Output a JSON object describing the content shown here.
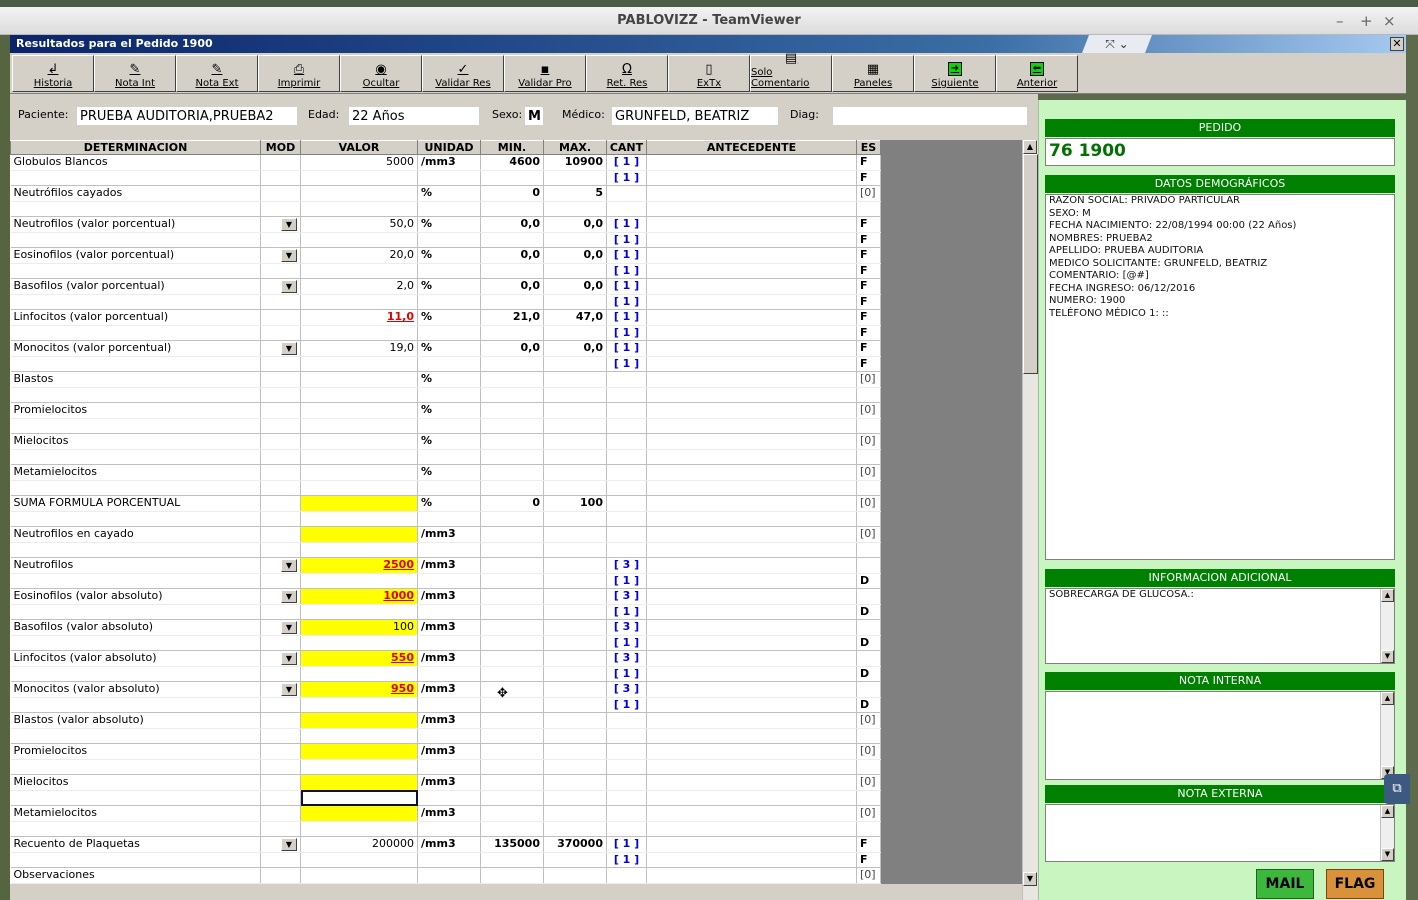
{
  "teamviewer": {
    "title": "PABLOVIZZ - TeamViewer",
    "min": "–",
    "max": "+",
    "close": "×"
  },
  "window": {
    "title": "Resultados para el Pedido 1900",
    "close": "✕"
  },
  "toolbar": [
    {
      "icon": "↲",
      "label": "Historia"
    },
    {
      "icon": "✎",
      "label": "Nota Int"
    },
    {
      "icon": "✎",
      "label": "Nota Ext"
    },
    {
      "icon": "⎙",
      "label": "Imprimir"
    },
    {
      "icon": "◉",
      "label": "Ocultar"
    },
    {
      "icon": "✓",
      "label": "Validar Res"
    },
    {
      "icon": "▪",
      "label": "Validar Pro"
    },
    {
      "icon": "Ω",
      "label": "Ret. Res"
    },
    {
      "icon": "▯",
      "label": "ExTx"
    },
    {
      "icon": "▤",
      "label": "Solo Comentario"
    },
    {
      "icon": "▦",
      "label": "Paneles"
    },
    {
      "icon": "➜",
      "label": "Siguiente"
    },
    {
      "icon": "⬅",
      "label": "Anterior"
    }
  ],
  "patient": {
    "paciente_label": "Paciente:",
    "paciente": "PRUEBA AUDITORIA,PRUEBA2",
    "edad_label": "Edad:",
    "edad": "22 Años",
    "sexo_label": "Sexo:",
    "sexo": "M",
    "medico_label": "Médico:",
    "medico": "GRUNFELD, BEATRIZ",
    "diag_label": "Diag:",
    "diag": ""
  },
  "columns": [
    "DETERMINACION",
    "MOD",
    "VALOR",
    "UNIDAD",
    "MIN.",
    "MAX.",
    "CANT",
    "ANTECEDENTE",
    "ES"
  ],
  "rows": [
    {
      "det": "Globulos Blancos",
      "mod": false,
      "val": "5000",
      "unit": "/mm3",
      "min": "4600",
      "max": "10900",
      "cant": "[ 1 ]",
      "es": "F",
      "cant2": "[ 1 ]",
      "es2": "F"
    },
    {
      "det": "Neutrófilos cayados",
      "mod": false,
      "val": "",
      "unit": "%",
      "min": "0",
      "max": "5",
      "cant": "",
      "es": "[0]"
    },
    {
      "det": "Neutrofilos  (valor porcentual)",
      "mod": true,
      "val": "50,0",
      "unit": "%",
      "min": "0,0",
      "max": "0,0",
      "cant": "[ 1 ]",
      "es": "F",
      "cant2": "[ 1 ]",
      "es2": "F"
    },
    {
      "det": "Eosinofilos (valor porcentual)",
      "mod": true,
      "val": "20,0",
      "unit": "%",
      "min": "0,0",
      "max": "0,0",
      "cant": "[ 1 ]",
      "es": "F",
      "cant2": "[ 1 ]",
      "es2": "F"
    },
    {
      "det": "Basofilos (valor porcentual)",
      "mod": true,
      "val": "2,0",
      "unit": "%",
      "min": "0,0",
      "max": "0,0",
      "cant": "[ 1 ]",
      "es": "F",
      "cant2": "[ 1 ]",
      "es2": "F"
    },
    {
      "det": "Linfocitos (valor porcentual)",
      "mod": false,
      "val": "11,0",
      "abn": true,
      "unit": "%",
      "min": "21,0",
      "max": "47,0",
      "cant": "[ 1 ]",
      "es": "F",
      "cant2": "[ 1 ]",
      "es2": "F"
    },
    {
      "det": "Monocitos (valor porcentual)",
      "mod": true,
      "val": "19,0",
      "unit": "%",
      "min": "0,0",
      "max": "0,0",
      "cant": "[ 1 ]",
      "es": "F",
      "cant2": "[ 1 ]",
      "es2": "F"
    },
    {
      "det": "Blastos",
      "mod": false,
      "val": "",
      "unit": "%",
      "min": "",
      "max": "",
      "cant": "",
      "es": "[0]"
    },
    {
      "det": "Promielocitos",
      "mod": false,
      "val": "",
      "unit": "%",
      "min": "",
      "max": "",
      "cant": "",
      "es": "[0]"
    },
    {
      "det": "Mielocitos",
      "mod": false,
      "val": "",
      "unit": "%",
      "min": "",
      "max": "",
      "cant": "",
      "es": "[0]"
    },
    {
      "det": "Metamielocitos",
      "mod": false,
      "val": "",
      "unit": "%",
      "min": "",
      "max": "",
      "cant": "",
      "es": "[0]"
    },
    {
      "det": "SUMA FORMULA PORCENTUAL",
      "mod": false,
      "val": "",
      "yellow": true,
      "unit": "%",
      "min": "0",
      "max": "100",
      "cant": "",
      "es": "[0]"
    },
    {
      "det": "Neutrofilos en cayado",
      "mod": false,
      "val": "",
      "yellow": true,
      "unit": "/mm3",
      "min": "",
      "max": "",
      "cant": "",
      "es": "[0]"
    },
    {
      "det": "Neutrofilos",
      "mod": true,
      "val": "2500",
      "yellow": true,
      "abn": true,
      "unit": "/mm3",
      "min": "",
      "max": "",
      "cant": "[ 3 ]",
      "es": "",
      "cant2": "[ 1 ]",
      "es2": "D"
    },
    {
      "det": "Eosinofilos (valor absoluto)",
      "mod": true,
      "val": "1000",
      "yellow": true,
      "abn": true,
      "unit": "/mm3",
      "min": "",
      "max": "",
      "cant": "[ 3 ]",
      "es": "",
      "cant2": "[ 1 ]",
      "es2": "D"
    },
    {
      "det": "Basofilos (valor absoluto)",
      "mod": true,
      "val": "100",
      "yellow": true,
      "unit": "/mm3",
      "min": "",
      "max": "",
      "cant": "[ 3 ]",
      "es": "",
      "cant2": "[ 1 ]",
      "es2": "D"
    },
    {
      "det": "Linfocitos (valor absoluto)",
      "mod": true,
      "val": "550",
      "yellow": true,
      "abn": true,
      "unit": "/mm3",
      "min": "",
      "max": "",
      "cant": "[ 3 ]",
      "es": "",
      "cant2": "[ 1 ]",
      "es2": "D"
    },
    {
      "det": "Monocitos (valor absoluto)",
      "mod": true,
      "val": "950",
      "yellow": true,
      "abn": true,
      "unit": "/mm3",
      "min": "",
      "max": "",
      "cant": "[ 3 ]",
      "es": "",
      "cant2": "[ 1 ]",
      "es2": "D"
    },
    {
      "det": "Blastos (valor absoluto)",
      "mod": false,
      "val": "",
      "yellow": true,
      "unit": "/mm3",
      "min": "",
      "max": "",
      "cant": "",
      "es": "[0]"
    },
    {
      "det": "Promielocitos",
      "mod": false,
      "val": "",
      "yellow": true,
      "unit": "/mm3",
      "min": "",
      "max": "",
      "cant": "",
      "es": "[0]"
    },
    {
      "det": "Mielocitos",
      "mod": false,
      "val": "",
      "yellow": true,
      "sel2": true,
      "unit": "/mm3",
      "min": "",
      "max": "",
      "cant": "",
      "es": "[0]"
    },
    {
      "det": "Metamielocitos",
      "mod": false,
      "val": "",
      "yellow": true,
      "unit": "/mm3",
      "min": "",
      "max": "",
      "cant": "",
      "es": "[0]"
    },
    {
      "det": "Recuento de Plaquetas",
      "mod": true,
      "val": "200000",
      "unit": "/mm3",
      "min": "135000",
      "max": "370000",
      "cant": "[ 1 ]",
      "es": "F",
      "cant2": "[ 1 ]",
      "es2": "F"
    },
    {
      "det": "Observaciones",
      "mod": false,
      "val": "",
      "unit": "",
      "min": "",
      "max": "",
      "cant": "",
      "es": "[0]"
    }
  ],
  "side": {
    "pedido_hdr": "PEDIDO",
    "pedido": "76 1900",
    "demo_hdr": "DATOS DEMOGRÁFICOS",
    "demo": [
      "RAZON SOCIAL: PRIVADO PARTICULAR",
      "SEXO: M",
      "FECHA NACIMIENTO: 22/08/1994 00:00 (22 Años)",
      "NOMBRES: PRUEBA2",
      "APELLIDO: PRUEBA AUDITORIA",
      "MEDICO SOLICITANTE: GRUNFELD, BEATRIZ",
      "COMENTARIO: [@#]",
      "FECHA INGRESO: 06/12/2016",
      "NUMERO: 1900",
      "TELÉFONO MÉDICO 1: ::"
    ],
    "info_hdr": "INFORMACION ADICIONAL",
    "info": "SOBRECARGA DE GLUCOSA.:",
    "nota_int_hdr": "NOTA INTERNA",
    "nota_ext_hdr": "NOTA EXTERNA",
    "mail": "MAIL",
    "flag": "FLAG"
  },
  "colors": {
    "accent": "#008000",
    "yellow": "#ffff00",
    "abnormal": "#e00000",
    "cant": "#0000e0"
  }
}
